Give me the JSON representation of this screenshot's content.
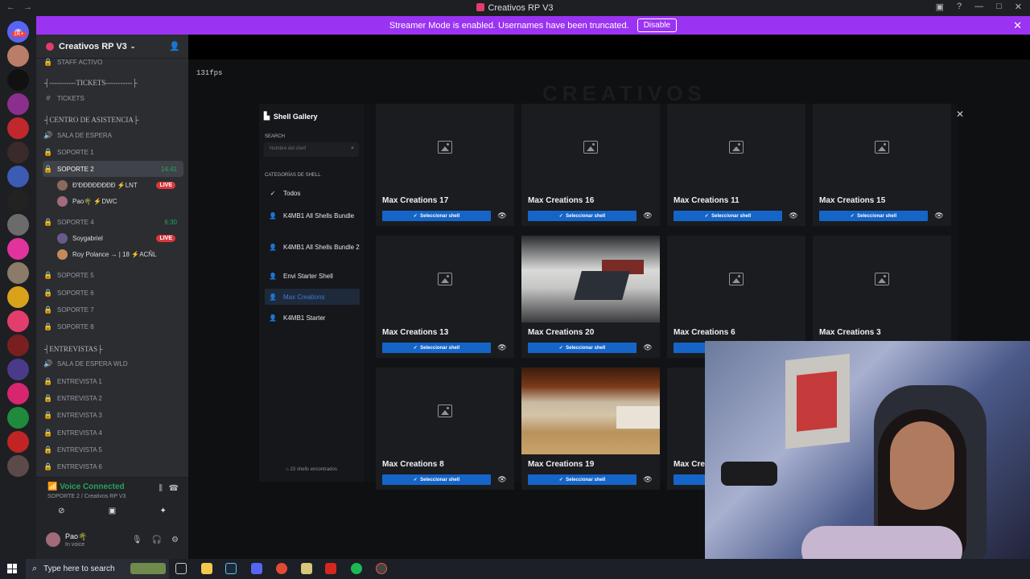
{
  "window": {
    "title": "Creativos RP V3"
  },
  "banner": {
    "text": "Streamer Mode is enabled. Usernames have been truncated.",
    "button": "Disable"
  },
  "rail": {
    "dm_badge": "1K+"
  },
  "server": {
    "name": "Creativos RP V3"
  },
  "channels": {
    "staff": "STAFF ACTIVO",
    "cat_tickets": "┤-----------TICKETS-----------├",
    "tickets": "TICKETS",
    "cat_asistencia": "┤CENTRO DE ASISTENCIA├",
    "sala_espera": "SALA DE ESPERA",
    "soporte1": "SOPORTE 1",
    "soporte2": "SOPORTE 2",
    "soporte2_time": "14:41",
    "user1": "Đ'ĐĐĐĐĐĐĐĐ ⚡LNT",
    "user1_badge": "LIVE",
    "user2": "Pao🌴 ⚡DWC",
    "soporte4": "SOPORTE 4",
    "soporte4_time": "6:30",
    "user3": "Soygabriel",
    "user3_badge": "LIVE",
    "user4": "Roy Polance → | 18 ⚡ACÑL",
    "soporte5": "SOPORTE 5",
    "soporte6": "SOPORTE 6",
    "soporte7": "SOPORTE 7",
    "soporte8": "SOPORTE 8",
    "cat_entrevistas": "┤ENTREVISTAS├",
    "sala_wld": "SALA DE ESPERA WLD",
    "ent1": "ENTREVISTA 1",
    "ent2": "ENTREVISTA 2",
    "ent3": "ENTREVISTA 3",
    "ent4": "ENTREVISTA 4",
    "ent5": "ENTREVISTA 5",
    "ent6": "ENTREVISTA 6"
  },
  "voice": {
    "status": "Voice Connected",
    "channel": "SOPORTE 2 / Creativos RP V3"
  },
  "user_panel": {
    "name": "Pao🌴",
    "status": "In voice"
  },
  "game": {
    "fps": "131fps",
    "watermark": "CREATIVOS"
  },
  "gallery": {
    "title": "Shell Gallery",
    "search_label": "SEARCH",
    "search_placeholder": "Nombre del shell",
    "categories_label": "CATEGORÍAS DE SHELL",
    "categories": [
      "Todos",
      "K4MB1 All Shells Bundle",
      "K4MB1 All Shells Bundle 2",
      "Envi Starter Shell",
      "Max Creations",
      "K4MB1 Starter"
    ],
    "footer": "23 shells encontrados",
    "select_label": "Seleccionar shell",
    "cards": [
      "Max Creations 17",
      "Max Creations 16",
      "Max Creations 11",
      "Max Creations 15",
      "Max Creations 13",
      "Max Creations 20",
      "Max Creations 6",
      "Max Creations 3",
      "Max Creations 8",
      "Max Creations 19",
      "Max Crea"
    ]
  },
  "taskbar": {
    "search": "Type here to search"
  }
}
